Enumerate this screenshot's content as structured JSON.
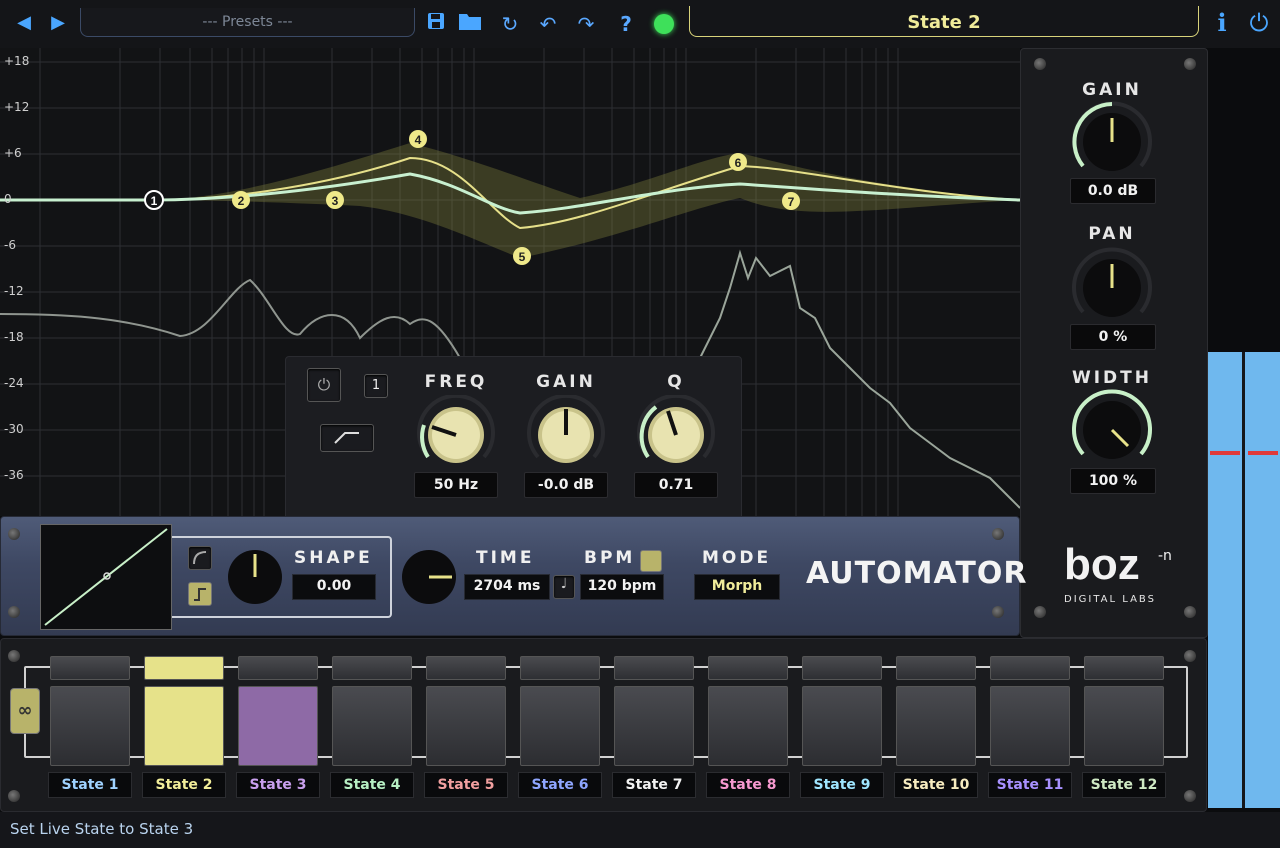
{
  "topbar": {
    "presets_placeholder": "--- Presets ---",
    "current_state": "State 2",
    "nav": [
      "prev-arrow-icon",
      "next-arrow-icon"
    ],
    "tools": [
      "save-icon",
      "folder-icon",
      "refresh-icon",
      "undo-icon",
      "redo-icon",
      "help-icon"
    ],
    "info": "i"
  },
  "eq": {
    "db_ticks": [
      "+18",
      "+12",
      "+6",
      "0",
      "-6",
      "-12",
      "-18",
      "-24",
      "-30",
      "-36"
    ],
    "nodes": [
      "1",
      "2",
      "3",
      "4",
      "5",
      "6",
      "7"
    ]
  },
  "band": {
    "number": "1",
    "freq_label": "FREQ",
    "freq_value": "50 Hz",
    "gain_label": "GAIN",
    "gain_value": "-0.0 dB",
    "q_label": "Q",
    "q_value": "0.71"
  },
  "master": {
    "gain_label": "GAIN",
    "gain_value": "0.0 dB",
    "pan_label": "PAN",
    "pan_value": "0 %",
    "width_label": "WIDTH",
    "width_value": "100 %",
    "brand": "boz",
    "brand_sup": "-n",
    "brand_sub": "DIGITAL LABS"
  },
  "automator": {
    "shape_label": "SHAPE",
    "shape_value": "0.00",
    "time_label": "TIME",
    "time_value": "2704 ms",
    "bpm_label": "BPM",
    "bpm_value": "120 bpm",
    "mode_label": "MODE",
    "mode_value": "Morph",
    "logo": "AUTOMATOR"
  },
  "states": [
    {
      "label": "State 1",
      "color": "#9fd2ff"
    },
    {
      "label": "State 2",
      "color": "#f2ee9a"
    },
    {
      "label": "State 3",
      "color": "#c9a0ee"
    },
    {
      "label": "State 4",
      "color": "#b7f0c4"
    },
    {
      "label": "State 5",
      "color": "#f2a0a0"
    },
    {
      "label": "State 6",
      "color": "#8fa6ff"
    },
    {
      "label": "State 7",
      "color": "#f2f2f2"
    },
    {
      "label": "State 8",
      "color": "#f79ad0"
    },
    {
      "label": "State 9",
      "color": "#9fe6ff"
    },
    {
      "label": "State 10",
      "color": "#f7ecc0"
    },
    {
      "label": "State 11",
      "color": "#a891ff"
    },
    {
      "label": "State 12",
      "color": "#cfe9c4"
    }
  ],
  "status": "Set Live State to State 3"
}
